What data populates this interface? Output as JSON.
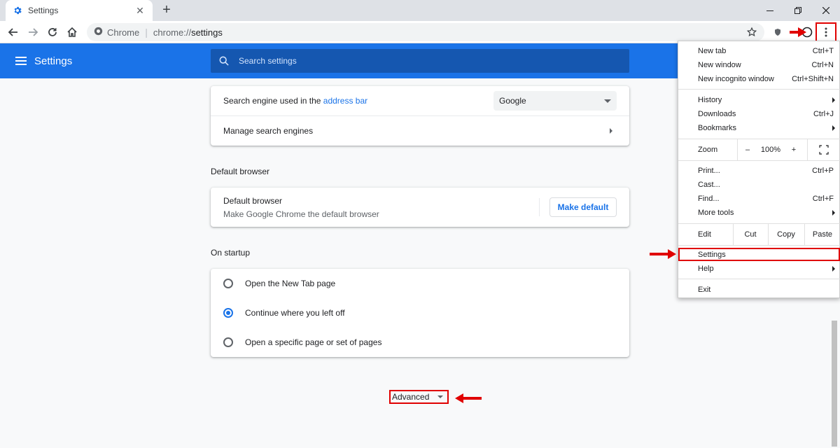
{
  "tab": {
    "title": "Settings",
    "close": "✕",
    "new": "+"
  },
  "window": {
    "minimize": "—",
    "maximize": "❐",
    "close": "✕"
  },
  "omnibox": {
    "site": "Chrome",
    "scheme": "chrome://",
    "host": "settings"
  },
  "header": {
    "title": "Settings",
    "search_placeholder": "Search settings"
  },
  "search_engine": {
    "label_prefix": "Search engine used in the ",
    "label_link": "address bar",
    "selected": "Google",
    "manage": "Manage search engines"
  },
  "default_browser": {
    "section": "Default browser",
    "title": "Default browser",
    "subtitle": "Make Google Chrome the default browser",
    "button": "Make default"
  },
  "startup": {
    "section": "On startup",
    "options": [
      {
        "label": "Open the New Tab page",
        "checked": false
      },
      {
        "label": "Continue where you left off",
        "checked": true
      },
      {
        "label": "Open a specific page or set of pages",
        "checked": false
      }
    ]
  },
  "advanced": {
    "label": "Advanced"
  },
  "menu": {
    "new_tab": {
      "label": "New tab",
      "shortcut": "Ctrl+T"
    },
    "new_window": {
      "label": "New window",
      "shortcut": "Ctrl+N"
    },
    "new_incognito": {
      "label": "New incognito window",
      "shortcut": "Ctrl+Shift+N"
    },
    "history": {
      "label": "History"
    },
    "downloads": {
      "label": "Downloads",
      "shortcut": "Ctrl+J"
    },
    "bookmarks": {
      "label": "Bookmarks"
    },
    "zoom": {
      "label": "Zoom",
      "minus": "–",
      "value": "100%",
      "plus": "+"
    },
    "print": {
      "label": "Print...",
      "shortcut": "Ctrl+P"
    },
    "cast": {
      "label": "Cast..."
    },
    "find": {
      "label": "Find...",
      "shortcut": "Ctrl+F"
    },
    "more_tools": {
      "label": "More tools"
    },
    "edit": {
      "label": "Edit",
      "cut": "Cut",
      "copy": "Copy",
      "paste": "Paste"
    },
    "settings": {
      "label": "Settings"
    },
    "help": {
      "label": "Help"
    },
    "exit": {
      "label": "Exit"
    }
  },
  "colors": {
    "accent": "#1a73e8",
    "annotation": "#e00000"
  }
}
